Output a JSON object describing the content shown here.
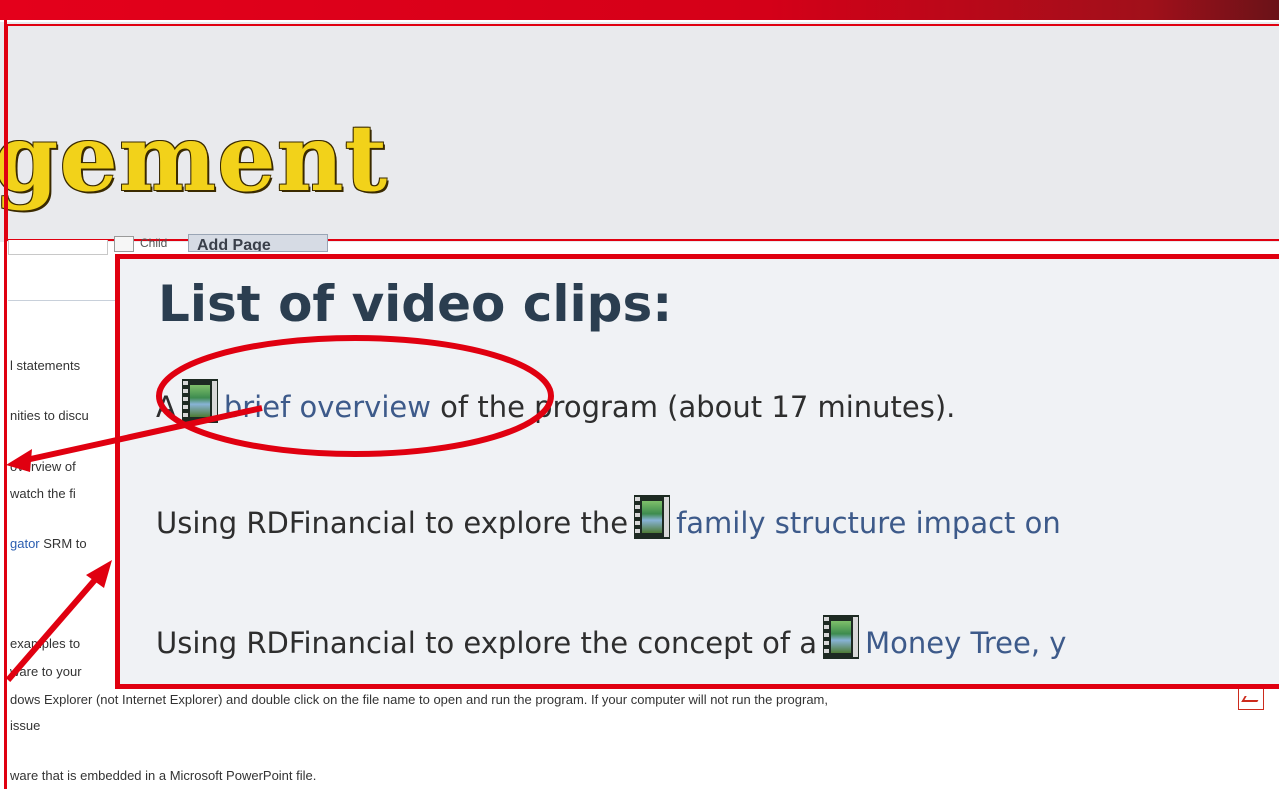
{
  "header": {
    "title_fragment": "gement"
  },
  "toolbar": {
    "child_label": "Child",
    "add_page_label": "Add Page"
  },
  "background_text": {
    "lines": [
      "l statements",
      "nities to discu",
      "overview of",
      "watch the fi",
      "SRM to",
      "examples to",
      "ware to your",
      "dows Explorer (not Internet Explorer) and double click on the file name to open and run the program. If your computer will not run the program,",
      "issue",
      "ware that is embedded in a Microsoft PowerPoint file."
    ],
    "link_text": "gator"
  },
  "panel": {
    "title": "List of video clips:",
    "clips": [
      {
        "prefix": "A",
        "link": "brief overview",
        "suffix": "of the program (about 17 minutes)."
      },
      {
        "prefix": "Using RDFinancial to explore the",
        "link": "family structure impact on",
        "suffix": ""
      },
      {
        "prefix": "Using RDFinancial to explore the concept of a",
        "link": "Money Tree, y",
        "suffix": ""
      }
    ]
  },
  "icons": {
    "clip_icon": "film-icon",
    "pdf_icon": "pdf-icon"
  },
  "colors": {
    "annotation": "#e00010",
    "title_gold": "#f2d21a",
    "link": "#3d5a8a"
  }
}
